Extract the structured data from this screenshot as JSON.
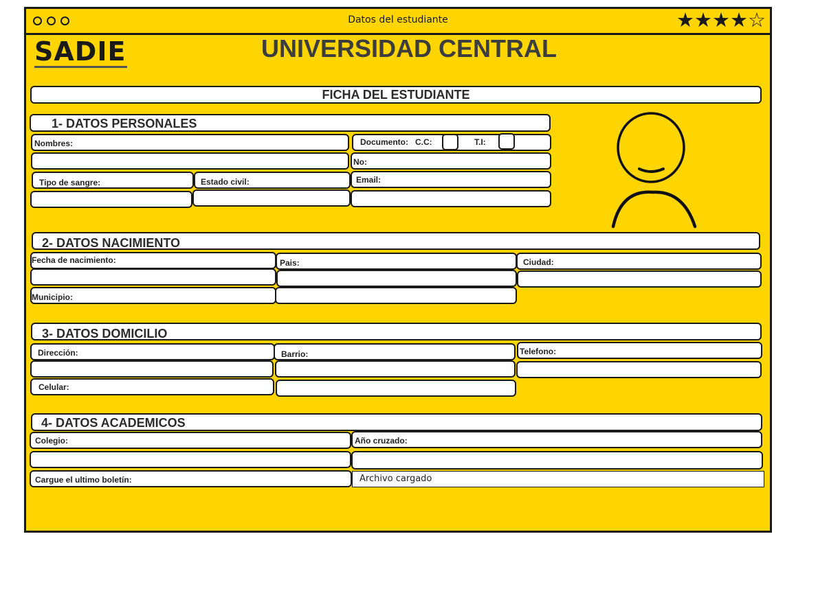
{
  "window": {
    "title": "Datos del estudiante",
    "rating_stars": "★★★★☆"
  },
  "header": {
    "logo": "SADIE",
    "university": "UNIVERSIDAD CENTRAL",
    "form_title": "FICHA DEL ESTUDIANTE"
  },
  "personal": {
    "heading": "1- DATOS PERSONALES",
    "nombres": "Nombres:",
    "documento": "Documento:",
    "cc": "C.C:",
    "ti": "T.I:",
    "no": "No:",
    "tipo_sangre": "Tipo de sangre:",
    "estado_civil": "Estado civil:",
    "email": "Email:"
  },
  "nacimiento": {
    "heading": "2- DATOS NACIMIENTO",
    "fecha": "Fecha de nacimiento:",
    "pais": "Pais:",
    "ciudad": "Ciudad:",
    "municipio": "Municipio:"
  },
  "domicilio": {
    "heading": "3- DATOS DOMICILIO",
    "direccion": "Dirección:",
    "barrio": "Barrio:",
    "telefono": "Telefono:",
    "celular": "Celular:"
  },
  "academicos": {
    "heading": "4- DATOS ACADEMICOS",
    "colegio": "Colegio:",
    "anio": "Año cruzado:",
    "boletin": "Cargue el ultimo boletín:",
    "archivo": "Archivo cargado"
  }
}
